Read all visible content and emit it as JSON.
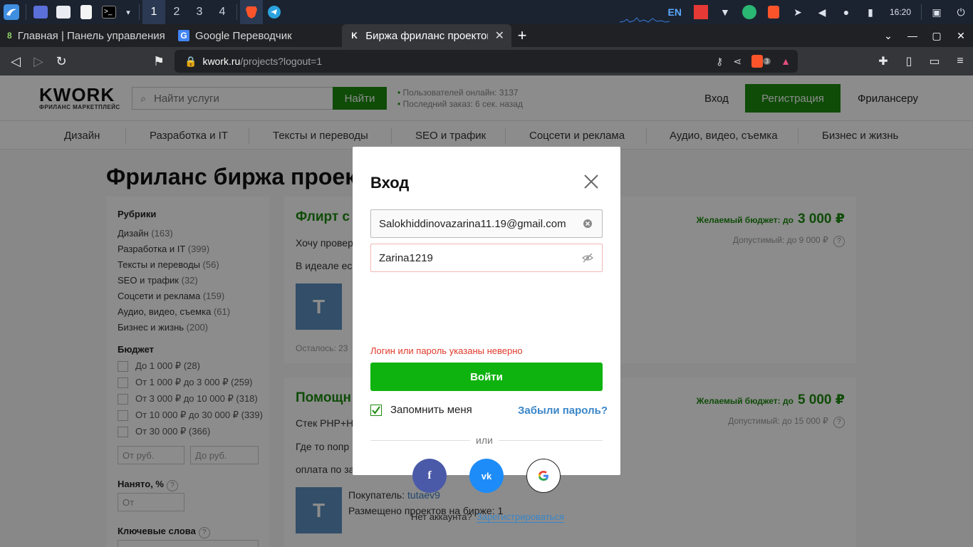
{
  "taskbar": {
    "workspaces": [
      "1",
      "2",
      "3",
      "4"
    ],
    "lang": "EN",
    "clock": "16:20"
  },
  "tabs": [
    {
      "label": "Главная | Панель управления"
    },
    {
      "label": "Google Переводчик"
    },
    {
      "label": "Биржа фриланс проектов"
    }
  ],
  "address": {
    "host": "kwork.ru",
    "path": "/projects?logout=1",
    "brave_badge": "3"
  },
  "header": {
    "logo": "KWORK",
    "logo_sub": "ФРИЛАНС МАРКЕТПЛЕЙС",
    "search_placeholder": "Найти услуги",
    "search_button": "Найти",
    "stats_online": "Пользователей онлайн: 3137",
    "stats_last": "Последний заказ: 6 сек. назад",
    "login": "Вход",
    "register": "Регистрация",
    "freelancer": "Фрилансеру"
  },
  "categories": [
    "Дизайн",
    "Разработка и IT",
    "Тексты и переводы",
    "SEO и трафик",
    "Соцсети и реклама",
    "Аудио, видео, съемка",
    "Бизнес и жизнь"
  ],
  "page_title": "Фриланс биржа проек",
  "sidebar": {
    "rubrics_title": "Рубрики",
    "rubrics": [
      {
        "label": "Дизайн",
        "count": "(163)"
      },
      {
        "label": "Разработка и IT",
        "count": "(399)"
      },
      {
        "label": "Тексты и переводы",
        "count": "(56)"
      },
      {
        "label": "SEO и трафик",
        "count": "(32)"
      },
      {
        "label": "Соцсети и реклама",
        "count": "(159)"
      },
      {
        "label": "Аудио, видео, съемка",
        "count": "(61)"
      },
      {
        "label": "Бизнес и жизнь",
        "count": "(200)"
      }
    ],
    "budget_title": "Бюджет",
    "budgets": [
      "До 1 000 ₽ (28)",
      "От 1 000 ₽ до 3 000 ₽ (259)",
      "От 3 000 ₽ до 10 000 ₽ (318)",
      "От 10 000 ₽ до 30 000 ₽ (339)",
      "От 30 000 ₽ (366)"
    ],
    "from_placeholder": "От руб.",
    "to_placeholder": "До руб.",
    "hired_title": "Нанято, %",
    "hired_placeholder": "От",
    "keywords_title": "Ключевые слова"
  },
  "cards": [
    {
      "title": "Флирт с",
      "line1": "Хочу провер",
      "line2": "В идеале ес",
      "avatar": "T",
      "remaining": "Осталось: 23",
      "budget_label": "Желаемый бюджет: до",
      "budget_amount": "3 000 ₽",
      "allowed": "Допустимый: до 9 000 ₽"
    },
    {
      "title": "Помощн",
      "line1": "Стек PHP+H",
      "line2": "Где то попр",
      "line3": "оплата по за",
      "avatar": "T",
      "buyer_label": "Покупатель:",
      "buyer_name": "tutaev9",
      "buyer_projects": "Размещено проектов на бирже: 1",
      "budget_label": "Желаемый бюджет: до",
      "budget_amount": "5 000 ₽",
      "allowed": "Допустимый: до 15 000 ₽"
    }
  ],
  "modal": {
    "title": "Вход",
    "email": "Salokhiddinovazarina11.19@gmail.com",
    "password": "Zarina1219",
    "error": "Логин или пароль указаны неверно",
    "submit": "Войти",
    "remember": "Запомнить меня",
    "forgot": "Забыли пароль?",
    "or": "или",
    "no_account": "Нет аккаунта?",
    "register_link": "Зарегистрироваться",
    "social": [
      "facebook-icon",
      "vk-icon",
      "google-icon"
    ]
  },
  "colors": {
    "brand_green": "#1d8a0f",
    "submit_green": "#0fb30f",
    "error_red": "#e0392a",
    "link_blue": "#3a86c8"
  }
}
